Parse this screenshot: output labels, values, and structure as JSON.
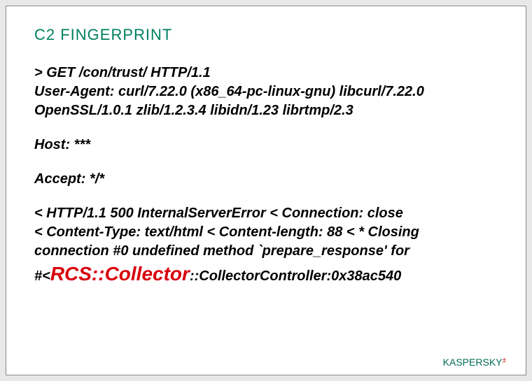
{
  "title": "C2 FINGERPRINT",
  "request": {
    "line1": "> GET /con/trust/ HTTP/1.1",
    "line2": "User-Agent: curl/7.22.0 (x86_64-pc-linux-gnu) libcurl/7.22.0 OpenSSL/1.0.1 zlib/1.2.3.4 libidn/1.23 librtmp/2.3"
  },
  "host": "Host: ***",
  "accept": "Accept: */*",
  "response": {
    "line1": "< HTTP/1.1 500 InternalServerError < Connection: close",
    "line2": "< Content-Type: text/html < Content-length: 88 < * Closing connection #0 undefined method `prepare_response' for",
    "final_prefix": "#<",
    "rcs": "RCS::Collector",
    "final_suffix": "::CollectorController:0x38ac540"
  },
  "footer": {
    "part1": "KASPER",
    "part2": "SKY",
    "mark": "±"
  }
}
